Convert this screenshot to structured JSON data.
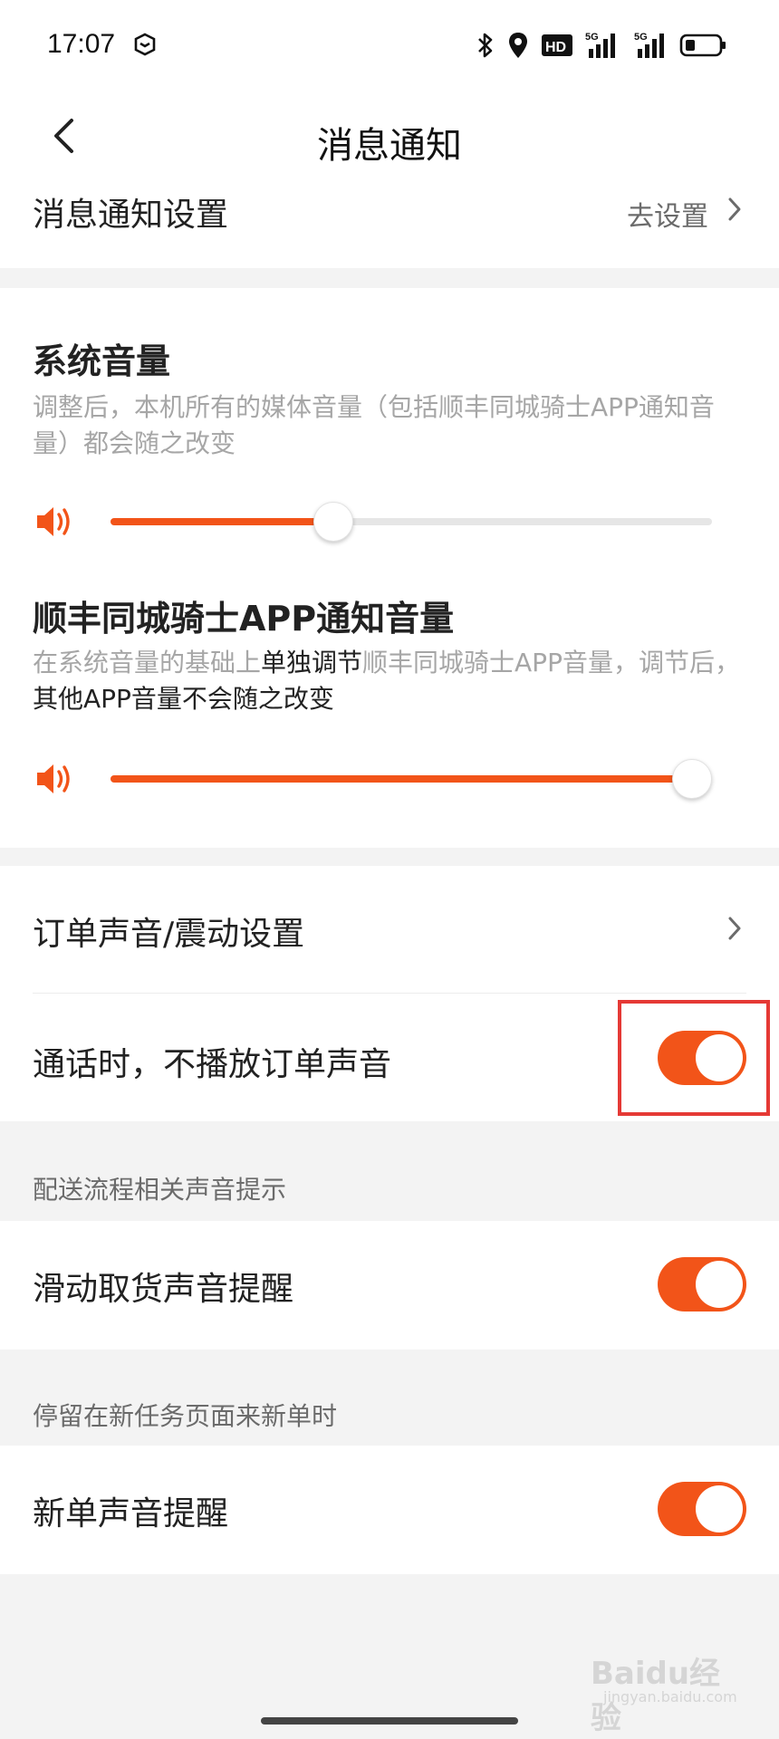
{
  "status_bar": {
    "time": "17:07",
    "icons": [
      "shield-icon",
      "bluetooth-icon",
      "location-icon",
      "hd-icon",
      "signal-5g-icon",
      "signal-5g-icon",
      "battery-icon"
    ],
    "hd_label": "HD",
    "net1_label": "5G",
    "net2_label": "5G"
  },
  "header": {
    "title": "消息通知",
    "back_icon": "chevron-left-icon"
  },
  "notification_settings": {
    "label": "消息通知设置",
    "action": "去设置"
  },
  "system_volume": {
    "title": "系统音量",
    "description": "调整后，本机所有的媒体音量（包括顺丰同城骑士APP通知音量）都会随之改变",
    "level": 0.37
  },
  "app_volume": {
    "title": "顺丰同城骑士APP通知音量",
    "description_pre": "在系统音量的基础上",
    "description_highlight": "单独调节",
    "description_mid": "顺丰同城骑士APP音量，调节后，",
    "description_highlight2": "其他APP音量不会随之改变",
    "level": 1.0
  },
  "order_sound": {
    "label": "订单声音/震动设置"
  },
  "mute_during_call": {
    "label": "通话时，不播放订单声音",
    "enabled": true
  },
  "delivery_group": {
    "caption": "配送流程相关声音提示",
    "item_label": "滑动取货声音提醒",
    "enabled": true
  },
  "new_task_group": {
    "caption": "停留在新任务页面来新单时",
    "item_label": "新单声音提醒",
    "enabled": true
  },
  "watermark": {
    "top": "Baidu经验",
    "bottom": "jingyan.baidu.com"
  },
  "colors": {
    "accent": "#f25419",
    "highlight_box": "#e53935"
  }
}
